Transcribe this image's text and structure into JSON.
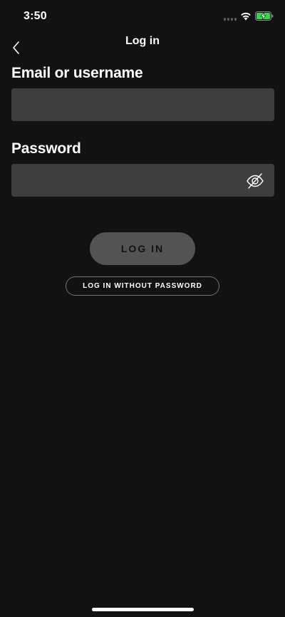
{
  "status_bar": {
    "time": "3:50",
    "icons": [
      "signal-icon",
      "wifi-icon",
      "battery-charging-icon"
    ],
    "battery_color": "#32d74b"
  },
  "header": {
    "title": "Log in",
    "back_icon": "chevron-left-icon"
  },
  "form": {
    "email_label": "Email or username",
    "email_value": "",
    "password_label": "Password",
    "password_value": "",
    "password_toggle_icon": "eye-slash-icon"
  },
  "actions": {
    "login_label": "LOG IN",
    "login_without_password_label": "LOG IN WITHOUT PASSWORD"
  },
  "colors": {
    "background": "#121212",
    "field_background": "#3e3e3e",
    "login_button_disabled": "#535353"
  }
}
